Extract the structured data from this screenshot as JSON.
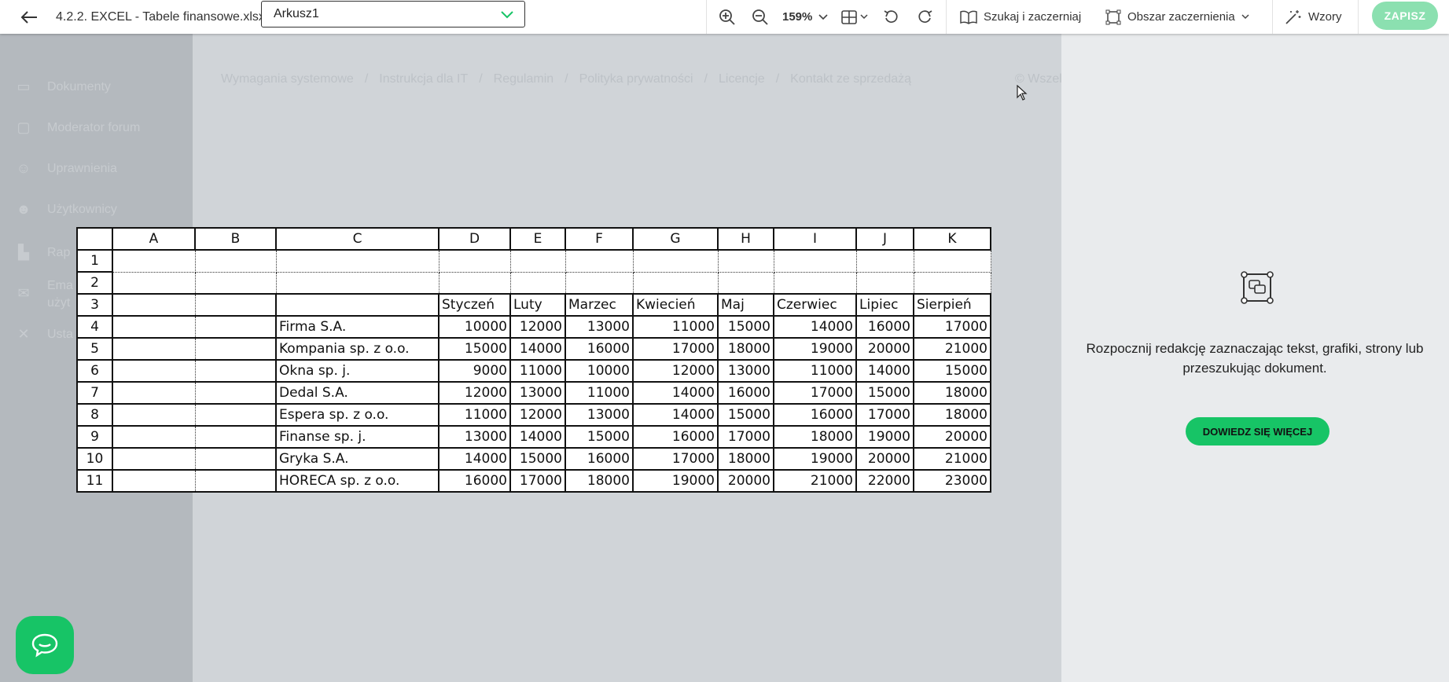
{
  "toolbar": {
    "document_title": "4.2.2. EXCEL - Tabele finansowe.xlsx",
    "sheet_selected": "Arkusz1",
    "zoom": "159%",
    "search_label": "Szukaj i zaczerniaj",
    "area_label": "Obszar zaczernienia",
    "patterns_label": "Wzory",
    "save_label": "ZAPISZ"
  },
  "nav": {
    "items": [
      {
        "label": "Dokumenty",
        "icon": "folder-icon"
      },
      {
        "label": "Moderator forum",
        "icon": "chat-icon"
      },
      {
        "label": "Uprawnienia",
        "icon": "user-key-icon"
      },
      {
        "label": "Użytkownicy",
        "icon": "users-icon"
      },
      {
        "label": "Rap",
        "icon": "chart-icon"
      },
      {
        "label": "Ema",
        "label2": "użyt",
        "icon": "mail-icon"
      },
      {
        "label": "Usta",
        "icon": "tools-icon"
      }
    ]
  },
  "breadcrumb": [
    "Wymagania systemowe",
    "/",
    "Instrukcja dla IT",
    "/",
    "Regulamin",
    "/",
    "Polityka prywatności",
    "/",
    "Licencje",
    "/",
    "Kontakt ze sprzedażą"
  ],
  "copyright": "© Wszel",
  "sheet": {
    "columns": [
      "A",
      "B",
      "C",
      "D",
      "E",
      "F",
      "G",
      "H",
      "I",
      "J",
      "K"
    ],
    "months": [
      "Styczeń",
      "Luty",
      "Marzec",
      "Kwiecień",
      "Maj",
      "Czerwiec",
      "Lipiec",
      "Sierpień"
    ],
    "rows": [
      {
        "name": "Firma S.A.",
        "values": [
          "10000",
          "12000",
          "13000",
          "11000",
          "15000",
          "14000",
          "16000",
          "17000"
        ]
      },
      {
        "name": "Kompania sp. z o.o.",
        "values": [
          "15000",
          "14000",
          "16000",
          "17000",
          "18000",
          "19000",
          "20000",
          "21000"
        ]
      },
      {
        "name": "Okna sp. j.",
        "values": [
          "9000",
          "11000",
          "10000",
          "12000",
          "13000",
          "11000",
          "14000",
          "15000"
        ]
      },
      {
        "name": "Dedal S.A.",
        "values": [
          "12000",
          "13000",
          "11000",
          "14000",
          "16000",
          "17000",
          "15000",
          "18000"
        ]
      },
      {
        "name": "Espera sp. z o.o.",
        "values": [
          "11000",
          "12000",
          "13000",
          "14000",
          "15000",
          "16000",
          "17000",
          "18000"
        ]
      },
      {
        "name": "Finanse sp. j.",
        "values": [
          "13000",
          "14000",
          "15000",
          "16000",
          "17000",
          "18000",
          "19000",
          "20000"
        ]
      },
      {
        "name": "Gryka S.A.",
        "values": [
          "14000",
          "15000",
          "16000",
          "17000",
          "18000",
          "19000",
          "20000",
          "21000"
        ]
      },
      {
        "name": "HORECA sp. z o.o.",
        "values": [
          "16000",
          "17000",
          "18000",
          "19000",
          "20000",
          "21000",
          "22000",
          "23000"
        ]
      }
    ]
  },
  "panel": {
    "message": "Rozpocznij redakcję zaznaczając tekst, grafiki, strony lub przeszukując dokument.",
    "learn_more": "DOWIEDZ SIĘ WIĘCEJ"
  },
  "colors": {
    "accent": "#17c466",
    "save_disabled": "#8be0b0"
  }
}
